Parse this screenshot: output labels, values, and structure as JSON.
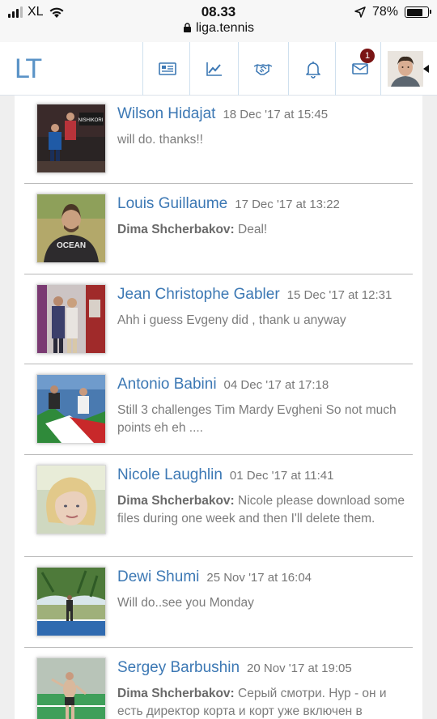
{
  "status_bar": {
    "carrier": "XL",
    "time": "08.33",
    "url": "liga.tennis",
    "battery": "78%",
    "battery_level": 0.78
  },
  "nav": {
    "logo": "LT",
    "icons": [
      "news-icon",
      "chart-icon",
      "handshake-icon",
      "bell-icon",
      "mail-icon"
    ],
    "mail_badge": "1"
  },
  "conversations": [
    {
      "name": "Wilson Hidajat",
      "date": "18 Dec '17 at 15:45",
      "sender": "",
      "text": "will do. thanks!!"
    },
    {
      "name": "Louis Guillaume",
      "date": "17 Dec '17 at 13:22",
      "sender": "Dima Shcherbakov:",
      "text": "Deal!"
    },
    {
      "name": "Jean Christophe Gabler",
      "date": "15 Dec '17 at 12:31",
      "sender": "",
      "text": "Ahh i guess Evgeny did , thank u anyway"
    },
    {
      "name": "Antonio Babini",
      "date": "04 Dec '17 at 17:18",
      "sender": "",
      "text": "Still 3 challenges Tim Mardy Evgheni So not much points eh eh ...."
    },
    {
      "name": "Nicole Laughlin",
      "date": "01 Dec '17 at 11:41",
      "sender": "Dima Shcherbakov:",
      "text": "Nicole please download some files during one week and then I'll delete them."
    },
    {
      "name": "Dewi Shumi",
      "date": "25 Nov '17 at 16:04",
      "sender": "",
      "text": "Will do..see you Monday"
    },
    {
      "name": "Sergey Barbushin",
      "date": "20 Nov '17 at 19:05",
      "sender": "Dima Shcherbakov:",
      "text": "Серый смотри. Нур - он и есть директор корта и корт уже включен в"
    }
  ],
  "thumb_labels": {
    "wilson_shirt": "NISHIKORI",
    "louis_shirt": "OCEAN"
  }
}
